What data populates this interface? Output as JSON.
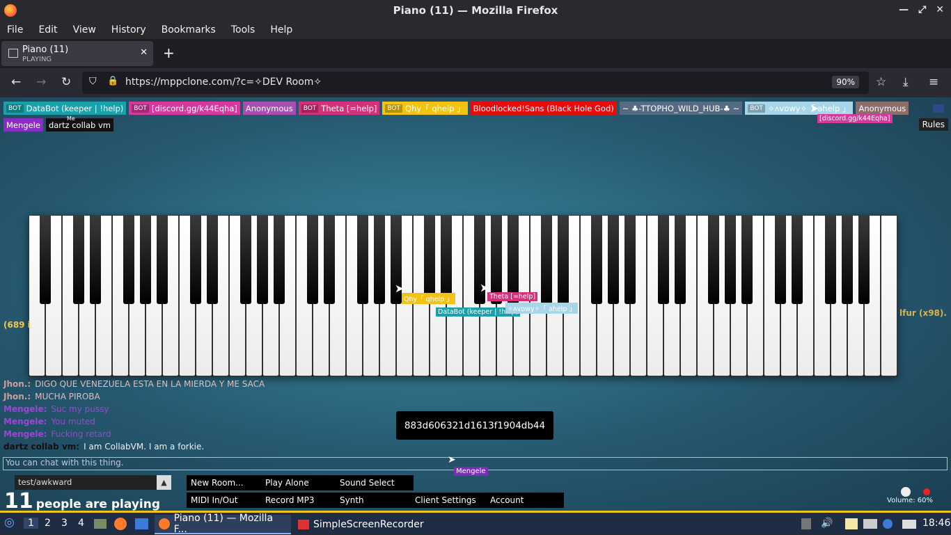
{
  "window": {
    "title": "Piano (11) — Mozilla Firefox"
  },
  "menubar": [
    "File",
    "Edit",
    "View",
    "History",
    "Bookmarks",
    "Tools",
    "Help"
  ],
  "tab": {
    "title": "Piano (11)",
    "status": "PLAYING"
  },
  "url": {
    "text": "https://mppclone.com/?c=✧DEV Room✧",
    "zoom": "90%"
  },
  "users": [
    {
      "label": "DataBot (keeper | !help)",
      "bot": true,
      "color": "#1aa0a8"
    },
    {
      "label": "[discord.gg/k44Eqha]",
      "bot": true,
      "color": "#d6399e"
    },
    {
      "label": "Anonymous",
      "bot": false,
      "color": "#a64fb0"
    },
    {
      "label": "Theta [=help]",
      "bot": true,
      "color": "#d5307a"
    },
    {
      "label": "Qhy「 qhelp 」",
      "bot": true,
      "color": "#f4c211"
    },
    {
      "label": "Bloodlocked!Sans (Black Hole God)",
      "bot": false,
      "color": "#e80b0b"
    },
    {
      "label": "~ ♣-TTOPHO_WILD_HUB-♣ ~",
      "bot": false,
      "color": "#546b83"
    },
    {
      "label": "✧ʌvɒwy✧「 ahelp 」",
      "bot": true,
      "color": "#a7d6ea"
    },
    {
      "label": "Anonymous",
      "bot": false,
      "color": "#8a6e6a"
    }
  ],
  "users_row2": [
    {
      "label": "Mengele",
      "color": "#8a2dc7"
    },
    {
      "label": "dartz collab vm",
      "color": "#111111",
      "me": "Me"
    }
  ],
  "discord_tag": "[discord.gg/k44Eqha]",
  "rules_label": "Rules",
  "piano": {
    "white_keys": 52
  },
  "cursor_tags": [
    {
      "label": "Qhy「 qhelp 」",
      "color": "#f4c211"
    },
    {
      "label": "Theta [=help]",
      "color": "#d5307a"
    },
    {
      "label": "DataBot (keeper | !help)",
      "color": "#1aa0a8"
    },
    {
      "label": "✧ʌvɒwy✧「 ahelp 」",
      "color": "#a7d6ea"
    }
  ],
  "chat": [
    {
      "name": "Jhon.:",
      "text": "DIGO QUE VENEZUELA ESTA EN LA MIERDA Y ME SACA",
      "ncolor": "#c9a0a0",
      "tcolor": "#e0bcbc"
    },
    {
      "name": "Jhon.:",
      "text": "MUCHA PIROBA",
      "ncolor": "#c9a0a0",
      "tcolor": "#e0bcbc"
    },
    {
      "name": "Mengele:",
      "text": "Suc my pussy",
      "ncolor": "#9b46d6",
      "tcolor": "#9b46d6"
    },
    {
      "name": "Mengele:",
      "text": "You muted",
      "ncolor": "#9b46d6",
      "tcolor": "#9b46d6"
    },
    {
      "name": "Mengele:",
      "text": "Fucking retard",
      "ncolor": "#9b46d6",
      "tcolor": "#9b46d6"
    },
    {
      "name": "dartz collab vm:",
      "text": "I am CollabVM. I am a forkie.",
      "ncolor": "#111111",
      "tcolor": "#eeeeee"
    }
  ],
  "side_fragments": {
    "right_text": "lfur (x98).",
    "left_689": "(689 i"
  },
  "id_box": "883d606321d1613f1904db44",
  "chat_placeholder": "You can chat with this thing.",
  "cursor_name": "Mengele",
  "room_select": "test/awkward",
  "player_count": {
    "number": "11",
    "text": "people are playing"
  },
  "buttons_row1": [
    "New Room...",
    "Play Alone",
    "Sound Select"
  ],
  "buttons_row2": [
    "MIDI In/Out",
    "Record MP3",
    "Synth",
    "Client Settings",
    "Account"
  ],
  "volume": "Volume: 60%",
  "taskbar": {
    "workspaces": [
      "1",
      "2",
      "3",
      "4"
    ],
    "tasks": [
      "Piano (11) — Mozilla F...",
      "SimpleScreenRecorder"
    ],
    "clock": "18:46"
  }
}
